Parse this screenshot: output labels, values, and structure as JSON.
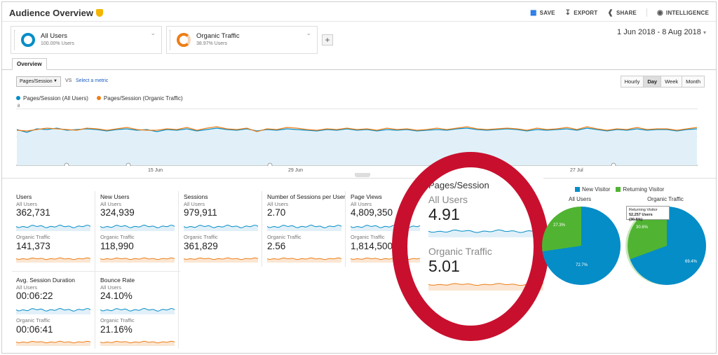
{
  "header": {
    "title": "Audience Overview",
    "actions": {
      "save": "SAVE",
      "export": "EXPORT",
      "share": "SHARE",
      "intelligence": "INTELLIGENCE"
    }
  },
  "segments": [
    {
      "name": "All Users",
      "pct": "100.00% Users",
      "color": "#058dc7"
    },
    {
      "name": "Organic Traffic",
      "pct": "38.97% Users",
      "color": "#ed7e17"
    }
  ],
  "date_range": "1 Jun 2018 - 8 Aug 2018",
  "tabs": {
    "overview": "Overview"
  },
  "metric_picker": {
    "selected": "Pages/Session",
    "vs": "VS",
    "select_metric": "Select a metric"
  },
  "granularity": {
    "hourly": "Hourly",
    "day": "Day",
    "week": "Week",
    "month": "Month",
    "active": "day"
  },
  "chart_data": {
    "type": "line",
    "series": [
      {
        "name": "Pages/Session (All Users)",
        "color": "#058dc7",
        "values": [
          5.0,
          4.6,
          5.1,
          5.0,
          5.2,
          4.9,
          5.0,
          5.1,
          5.0,
          4.8,
          5.0,
          5.1,
          4.9,
          5.0,
          4.7,
          5.0,
          4.9,
          5.1,
          4.8,
          5.0,
          5.2,
          5.0,
          4.9,
          5.1,
          4.8,
          5.0,
          4.9,
          5.1,
          5.0,
          4.9,
          4.8,
          5.0,
          4.9,
          5.1,
          4.9,
          5.0,
          4.8,
          5.0,
          4.9,
          5.0,
          4.8,
          4.9,
          5.0,
          4.9,
          5.1,
          5.2,
          5.0,
          4.9,
          5.0,
          5.1,
          5.0,
          4.8,
          5.0,
          4.9,
          5.0,
          5.1,
          4.9,
          5.2,
          5.0,
          4.8,
          5.0,
          4.9,
          5.1,
          4.9,
          5.0,
          5.0,
          4.8,
          5.0,
          5.1
        ]
      },
      {
        "name": "Pages/Session (Organic Traffic)",
        "color": "#ed7e17",
        "values": [
          4.9,
          4.8,
          5.0,
          5.2,
          5.1,
          5.0,
          4.9,
          5.2,
          5.1,
          4.9,
          5.1,
          5.3,
          5.0,
          4.9,
          4.9,
          5.1,
          5.0,
          5.3,
          4.9,
          5.2,
          5.4,
          5.1,
          5.0,
          5.2,
          4.7,
          5.1,
          5.0,
          5.3,
          5.2,
          5.0,
          4.9,
          5.1,
          5.0,
          5.2,
          5.0,
          5.1,
          4.9,
          5.2,
          5.0,
          5.1,
          4.9,
          5.0,
          5.2,
          5.0,
          5.2,
          5.4,
          5.1,
          5.0,
          5.1,
          5.2,
          5.1,
          4.9,
          5.2,
          5.0,
          5.1,
          5.3,
          5.0,
          5.4,
          5.1,
          4.9,
          5.1,
          5.0,
          5.3,
          5.0,
          5.1,
          5.1,
          4.9,
          5.1,
          5.3
        ]
      }
    ],
    "yticks": [
      "8",
      "4"
    ],
    "ylim": [
      0,
      8
    ],
    "xticks": [
      "15 Jun",
      "29 Jun",
      "27 Jul"
    ],
    "grid": true
  },
  "metrics": [
    {
      "label": "Users",
      "all": "362,731",
      "organic": "141,373"
    },
    {
      "label": "New Users",
      "all": "324,939",
      "organic": "118,990"
    },
    {
      "label": "Sessions",
      "all": "979,911",
      "organic": "361,829"
    },
    {
      "label": "Number of Sessions per User",
      "all": "2.70",
      "organic": "2.56"
    },
    {
      "label": "Page Views",
      "all": "4,809,350",
      "organic": "1,814,500"
    },
    {
      "label": "Avg. Session Duration",
      "all": "00:06:22",
      "organic": "00:06:41"
    },
    {
      "label": "Bounce Rate",
      "all": "24.10%",
      "organic": "21.16%"
    }
  ],
  "segment_labels": {
    "all": "All Users",
    "organic": "Organic Traffic"
  },
  "zoom_callout": {
    "label": "Pages/Session",
    "all_label": "All Users",
    "all_value": "4.91",
    "organic_label": "Organic Traffic",
    "organic_value": "5.01"
  },
  "pies": {
    "legend": [
      {
        "name": "New Visitor",
        "color": "#058dc7"
      },
      {
        "name": "Returning Visitor",
        "color": "#50b432"
      }
    ],
    "charts": [
      {
        "title": "All Users",
        "new_pct": 72.7,
        "ret_pct": 27.3,
        "new_label": "72.7%",
        "ret_label": "27.3%"
      },
      {
        "title": "Organic Traffic",
        "new_pct": 69.4,
        "ret_pct": 30.6,
        "new_label": "69.4%",
        "ret_label": "30.6%"
      }
    ],
    "tooltip": {
      "title": "Returning Visitor",
      "value": "52,257 Users (30.6%)"
    }
  }
}
